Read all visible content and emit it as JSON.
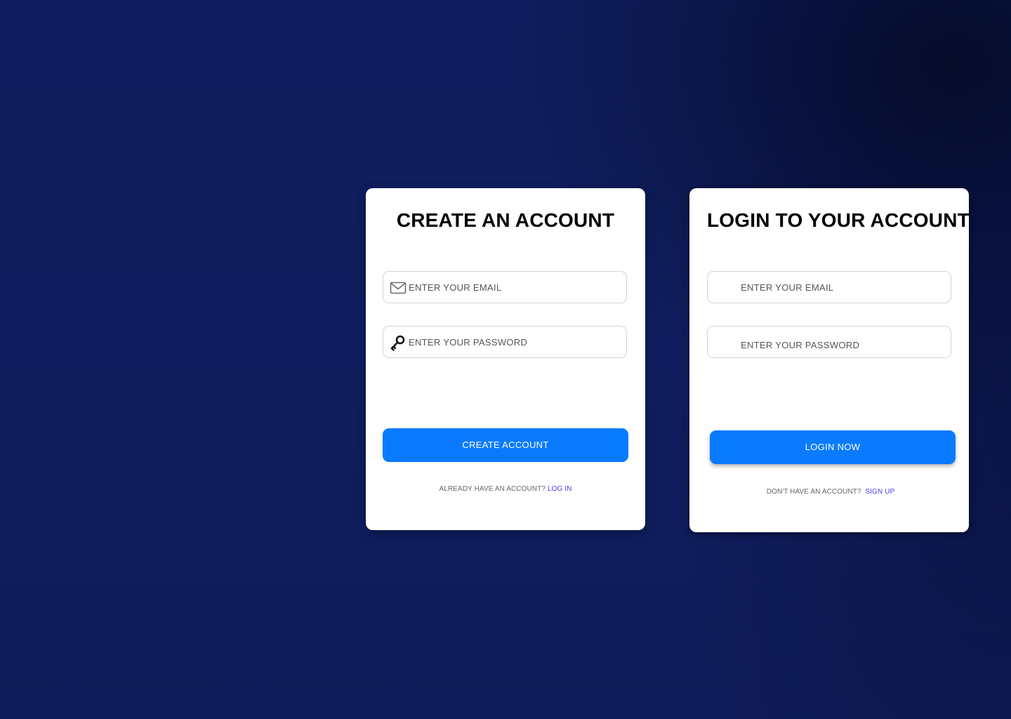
{
  "signup": {
    "title": "CREATE AN ACCOUNT",
    "email_placeholder": "ENTER YOUR EMAIL",
    "password_placeholder": "ENTER YOUR PASSWORD",
    "button_label": "CREATE ACCOUNT",
    "footer_text": "ALREADY HAVE AN ACCOUNT?",
    "footer_link": "LOG IN",
    "email_icon": "mail-icon",
    "password_icon": "key-icon"
  },
  "login": {
    "title": "LOGIN TO YOUR ACCOUNT",
    "email_placeholder": "ENTER YOUR EMAIL",
    "password_placeholder": "ENTER YOUR PASSWORD",
    "button_label": "LOGIN NOW",
    "footer_text": "DON'T HAVE AN ACCOUNT?",
    "footer_link": "SIGN UP"
  },
  "colors": {
    "accent": "#0a7bff",
    "link": "#4b3cf0",
    "background": "#101d5c"
  }
}
